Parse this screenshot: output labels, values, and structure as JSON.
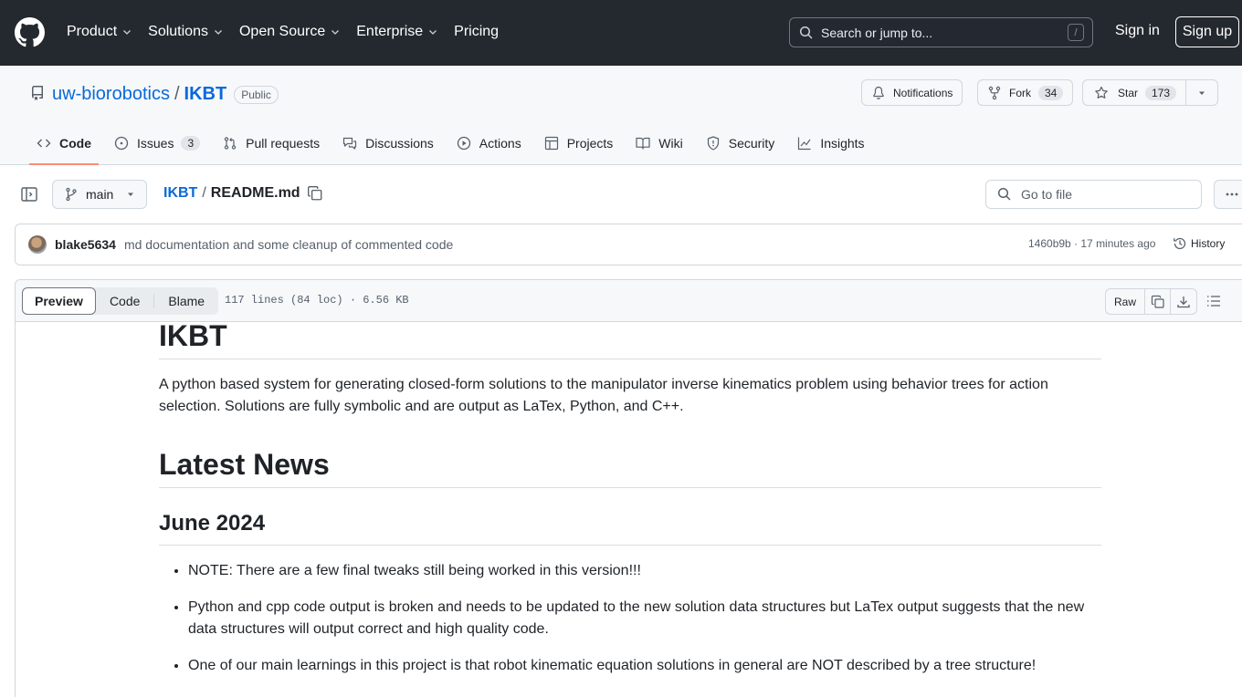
{
  "topnav": {
    "items": [
      {
        "label": "Product"
      },
      {
        "label": "Solutions"
      },
      {
        "label": "Open Source"
      },
      {
        "label": "Enterprise"
      },
      {
        "label": "Pricing"
      }
    ],
    "search_placeholder": "Search or jump to...",
    "search_key": "/",
    "signin": "Sign in",
    "signup": "Sign up"
  },
  "repo": {
    "owner": "uw-biorobotics",
    "sep": "/",
    "name": "IKBT",
    "visibility": "Public",
    "notifications_label": "Notifications",
    "fork_label": "Fork",
    "fork_count": "34",
    "star_label": "Star",
    "star_count": "173"
  },
  "tabs": [
    {
      "label": "Code",
      "icon": "code-icon",
      "active": true
    },
    {
      "label": "Issues",
      "icon": "issue-icon",
      "count": "3"
    },
    {
      "label": "Pull requests",
      "icon": "pull-request-icon"
    },
    {
      "label": "Discussions",
      "icon": "discussions-icon"
    },
    {
      "label": "Actions",
      "icon": "play-icon"
    },
    {
      "label": "Projects",
      "icon": "table-icon"
    },
    {
      "label": "Wiki",
      "icon": "book-icon"
    },
    {
      "label": "Security",
      "icon": "shield-icon"
    },
    {
      "label": "Insights",
      "icon": "graph-icon"
    }
  ],
  "file": {
    "branch": "main",
    "crumb_repo": "IKBT",
    "crumb_sep": "/",
    "filename": "README.md",
    "goto_placeholder": "Go to file",
    "info": "117 lines (84 loc) · 6.56 KB",
    "view_tabs": [
      "Preview",
      "Code",
      "Blame"
    ],
    "raw_label": "Raw"
  },
  "commit": {
    "author": "blake5634",
    "message": "md documentation and some cleanup of commented code",
    "meta": "1460b9b · 17 minutes ago",
    "history_label": "History"
  },
  "readme": {
    "title": "IKBT",
    "intro": "A python based system for generating closed-form solutions to the manipulator inverse kinematics problem using behavior trees for action selection. Solutions are fully symbolic and are output as LaTex, Python, and C++.",
    "news_heading": "Latest News",
    "month_heading": "June 2024",
    "bullets": [
      "NOTE: There are a few final tweaks still being worked in this version!!!",
      "Python and cpp code output is broken and needs to be updated to the new solution data structures but LaTex output suggests that the new data structures will output correct and high quality code.",
      "One of our main learnings in this project is that robot kinematic equation solutions in general are NOT described by a tree structure!"
    ]
  },
  "colors": {
    "header_bg": "#24292f",
    "link": "#0969da",
    "active_tab_underline": "#fd8c73"
  }
}
